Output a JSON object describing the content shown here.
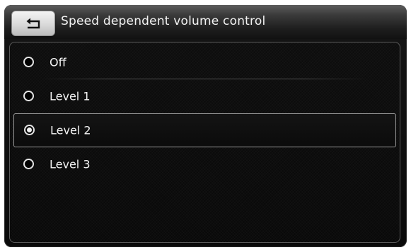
{
  "header": {
    "title": "Speed dependent volume control",
    "back_icon": "back-arrow-icon"
  },
  "options": [
    {
      "label": "Off",
      "selected": false
    },
    {
      "label": "Level 1",
      "selected": false
    },
    {
      "label": "Level 2",
      "selected": true
    },
    {
      "label": "Level 3",
      "selected": false
    }
  ],
  "colors": {
    "text": "#f4f4f4",
    "selection_border": "#9a9a9a",
    "panel_border": "#5a5a5a"
  }
}
